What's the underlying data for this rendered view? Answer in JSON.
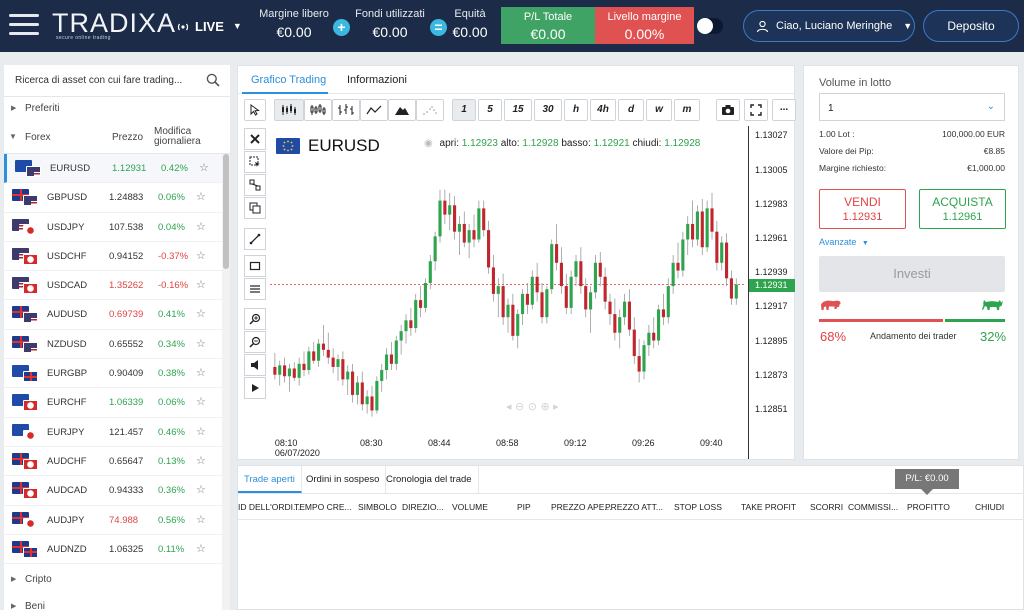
{
  "header": {
    "logo": "TRADIXA",
    "logo_tagline": "secure online trading",
    "account_mode": "LIVE",
    "free_margin_label": "Margine libero",
    "free_margin_value": "€0.00",
    "used_funds_label": "Fondi utilizzati",
    "used_funds_value": "€0.00",
    "equity_label": "Equità",
    "equity_value": "€0.00",
    "total_pl_label": "P/L Totale",
    "total_pl_value": "€0.00",
    "margin_level_label": "Livello margine",
    "margin_level_value": "0.00%",
    "greeting": "Ciao, Luciano Meringhe",
    "deposit_label": "Deposito",
    "colors": {
      "bg": "#1b2b48",
      "pl": "#3fa365",
      "margin": "#e05151",
      "accent": "#3c79c9"
    }
  },
  "sidebar": {
    "search_placeholder": "Ricerca di asset con cui fare trading...",
    "favorites_label": "Preferiti",
    "forex_label": "Forex",
    "col_price": "Prezzo",
    "col_change_1": "Modifica",
    "col_change_2": "giornaliera",
    "crypto_label": "Cripto",
    "goods_label": "Beni",
    "instruments": [
      {
        "symbol": "EURUSD",
        "price": "1.12931",
        "change": "0.42%",
        "price_dir": "up",
        "change_dir": "up",
        "f1": "eu",
        "f2": "us"
      },
      {
        "symbol": "GBPUSD",
        "price": "1.24883",
        "change": "0.06%",
        "price_dir": "flat",
        "change_dir": "up",
        "f1": "gb",
        "f2": "us"
      },
      {
        "symbol": "USDJPY",
        "price": "107.538",
        "change": "0.04%",
        "price_dir": "flat",
        "change_dir": "up",
        "f1": "us",
        "f2": "jp"
      },
      {
        "symbol": "USDCHF",
        "price": "0.94152",
        "change": "-0.37%",
        "price_dir": "flat",
        "change_dir": "down",
        "f1": "us",
        "f2": "ch"
      },
      {
        "symbol": "USDCAD",
        "price": "1.35262",
        "change": "-0.16%",
        "price_dir": "down",
        "change_dir": "down",
        "f1": "us",
        "f2": "ca"
      },
      {
        "symbol": "AUDUSD",
        "price": "0.69739",
        "change": "0.41%",
        "price_dir": "down",
        "change_dir": "up",
        "f1": "au",
        "f2": "us"
      },
      {
        "symbol": "NZDUSD",
        "price": "0.65552",
        "change": "0.34%",
        "price_dir": "flat",
        "change_dir": "up",
        "f1": "nz",
        "f2": "us"
      },
      {
        "symbol": "EURGBP",
        "price": "0.90409",
        "change": "0.38%",
        "price_dir": "flat",
        "change_dir": "up",
        "f1": "eu",
        "f2": "gb"
      },
      {
        "symbol": "EURCHF",
        "price": "1.06339",
        "change": "0.06%",
        "price_dir": "up",
        "change_dir": "up",
        "f1": "eu",
        "f2": "ch"
      },
      {
        "symbol": "EURJPY",
        "price": "121.457",
        "change": "0.46%",
        "price_dir": "flat",
        "change_dir": "up",
        "f1": "eu",
        "f2": "jp"
      },
      {
        "symbol": "AUDCHF",
        "price": "0.65647",
        "change": "0.13%",
        "price_dir": "flat",
        "change_dir": "up",
        "f1": "au",
        "f2": "ch"
      },
      {
        "symbol": "AUDCAD",
        "price": "0.94333",
        "change": "0.36%",
        "price_dir": "flat",
        "change_dir": "up",
        "f1": "au",
        "f2": "ca"
      },
      {
        "symbol": "AUDJPY",
        "price": "74.988",
        "change": "0.56%",
        "price_dir": "down",
        "change_dir": "up",
        "f1": "au",
        "f2": "jp"
      },
      {
        "symbol": "AUDNZD",
        "price": "1.06325",
        "change": "0.11%",
        "price_dir": "flat",
        "change_dir": "up",
        "f1": "au",
        "f2": "nz"
      }
    ]
  },
  "chart_panel": {
    "tab_chart": "Grafico Trading",
    "tab_info": "Informazioni",
    "timeframes": [
      "1",
      "5",
      "15",
      "30",
      "h",
      "4h",
      "d",
      "w",
      "m"
    ],
    "selected_timeframe": "1",
    "more_label": "...",
    "symbol": "EURUSD",
    "ohlc_open_label": "apri:",
    "ohlc_open": "1.12923",
    "ohlc_high_label": "alto:",
    "ohlc_high": "1.12928",
    "ohlc_low_label": "basso:",
    "ohlc_low": "1.12921",
    "ohlc_close_label": "chiudi:",
    "ohlc_close": "1.12928",
    "current_price": "1.12931"
  },
  "chart_data": {
    "type": "candlestick",
    "y_ticks": [
      "1.13027",
      "1.13005",
      "1.12983",
      "1.12961",
      "1.12939",
      "1.12917",
      "1.12895",
      "1.12873",
      "1.12851"
    ],
    "ylim": [
      1.1284,
      1.13033
    ],
    "x_ticks": [
      {
        "label": "08:10",
        "sub": "06/07/2020",
        "index": 0
      },
      {
        "label": "08:30",
        "index": 20
      },
      {
        "label": "08:44",
        "index": 34
      },
      {
        "label": "08:58",
        "index": 48
      },
      {
        "label": "09:12",
        "index": 62
      },
      {
        "label": "09:26",
        "index": 76
      },
      {
        "label": "09:40",
        "index": 90
      }
    ],
    "candles": [
      [
        1.12878,
        1.12887,
        1.1287,
        1.12873
      ],
      [
        1.12873,
        1.12882,
        1.12866,
        1.12879
      ],
      [
        1.12879,
        1.12884,
        1.12868,
        1.12872
      ],
      [
        1.12872,
        1.1288,
        1.12862,
        1.12877
      ],
      [
        1.12877,
        1.12881,
        1.12869,
        1.12871
      ],
      [
        1.12871,
        1.12884,
        1.12866,
        1.1288
      ],
      [
        1.1288,
        1.12888,
        1.12872,
        1.12876
      ],
      [
        1.12876,
        1.12891,
        1.12873,
        1.12888
      ],
      [
        1.12888,
        1.12894,
        1.1288,
        1.12882
      ],
      [
        1.12882,
        1.12896,
        1.12878,
        1.12893
      ],
      [
        1.12893,
        1.12905,
        1.12885,
        1.12889
      ],
      [
        1.12889,
        1.129,
        1.1288,
        1.12884
      ],
      [
        1.12884,
        1.1289,
        1.12874,
        1.12878
      ],
      [
        1.12878,
        1.12886,
        1.12869,
        1.12883
      ],
      [
        1.12883,
        1.12888,
        1.12866,
        1.1287
      ],
      [
        1.1287,
        1.12879,
        1.1286,
        1.12875
      ],
      [
        1.12875,
        1.1288,
        1.12855,
        1.1286
      ],
      [
        1.1286,
        1.12872,
        1.12854,
        1.12868
      ],
      [
        1.12868,
        1.12875,
        1.1285,
        1.12854
      ],
      [
        1.12854,
        1.12863,
        1.12848,
        1.12859
      ],
      [
        1.12859,
        1.12866,
        1.12846,
        1.1285
      ],
      [
        1.1285,
        1.12872,
        1.12848,
        1.12869
      ],
      [
        1.12869,
        1.1288,
        1.12862,
        1.12876
      ],
      [
        1.12876,
        1.1289,
        1.1287,
        1.12886
      ],
      [
        1.12886,
        1.12894,
        1.12876,
        1.1288
      ],
      [
        1.1288,
        1.12898,
        1.12876,
        1.12895
      ],
      [
        1.12895,
        1.12905,
        1.12886,
        1.12901
      ],
      [
        1.12901,
        1.12912,
        1.12893,
        1.12908
      ],
      [
        1.12908,
        1.12916,
        1.12898,
        1.12903
      ],
      [
        1.12903,
        1.12925,
        1.129,
        1.12921
      ],
      [
        1.12921,
        1.1293,
        1.1291,
        1.12916
      ],
      [
        1.12916,
        1.12935,
        1.12913,
        1.12932
      ],
      [
        1.12932,
        1.1295,
        1.12928,
        1.12946
      ],
      [
        1.12946,
        1.12965,
        1.1294,
        1.12962
      ],
      [
        1.12962,
        1.12992,
        1.12958,
        1.12985
      ],
      [
        1.12985,
        1.12992,
        1.1297,
        1.12976
      ],
      [
        1.12976,
        1.1299,
        1.12966,
        1.12982
      ],
      [
        1.12982,
        1.12988,
        1.1296,
        1.12965
      ],
      [
        1.12965,
        1.12975,
        1.1295,
        1.1297
      ],
      [
        1.1297,
        1.12978,
        1.12955,
        1.12958
      ],
      [
        1.12958,
        1.1297,
        1.12948,
        1.12966
      ],
      [
        1.12966,
        1.12976,
        1.12955,
        1.1296
      ],
      [
        1.1296,
        1.12985,
        1.12958,
        1.1298
      ],
      [
        1.1298,
        1.12985,
        1.12962,
        1.12966
      ],
      [
        1.12966,
        1.12972,
        1.12938,
        1.12942
      ],
      [
        1.12942,
        1.1295,
        1.1292,
        1.12925
      ],
      [
        1.12925,
        1.12935,
        1.1291,
        1.1293
      ],
      [
        1.1293,
        1.12938,
        1.12905,
        1.1291
      ],
      [
        1.1291,
        1.12922,
        1.129,
        1.12918
      ],
      [
        1.12918,
        1.12925,
        1.12895,
        1.12898
      ],
      [
        1.12898,
        1.12915,
        1.1289,
        1.12912
      ],
      [
        1.12912,
        1.12928,
        1.12905,
        1.12925
      ],
      [
        1.12925,
        1.12932,
        1.12912,
        1.12918
      ],
      [
        1.12918,
        1.1294,
        1.12915,
        1.12936
      ],
      [
        1.12936,
        1.12945,
        1.1292,
        1.12926
      ],
      [
        1.12926,
        1.12932,
        1.12906,
        1.1291
      ],
      [
        1.1291,
        1.1293,
        1.12906,
        1.12928
      ],
      [
        1.12928,
        1.1296,
        1.12925,
        1.12957
      ],
      [
        1.12957,
        1.1297,
        1.1294,
        1.12945
      ],
      [
        1.12945,
        1.12955,
        1.12925,
        1.1293
      ],
      [
        1.1293,
        1.12938,
        1.12912,
        1.12916
      ],
      [
        1.12916,
        1.1294,
        1.12912,
        1.12936
      ],
      [
        1.12936,
        1.1295,
        1.1293,
        1.12946
      ],
      [
        1.12946,
        1.12955,
        1.12925,
        1.1293
      ],
      [
        1.1293,
        1.12935,
        1.1291,
        1.12915
      ],
      [
        1.12915,
        1.1293,
        1.129,
        1.12926
      ],
      [
        1.12926,
        1.1295,
        1.12922,
        1.12945
      ],
      [
        1.12945,
        1.12952,
        1.1293,
        1.12936
      ],
      [
        1.12936,
        1.12942,
        1.12915,
        1.1292
      ],
      [
        1.1292,
        1.12925,
        1.12905,
        1.12912
      ],
      [
        1.12912,
        1.12922,
        1.12895,
        1.129
      ],
      [
        1.129,
        1.12915,
        1.1289,
        1.1291
      ],
      [
        1.1291,
        1.12925,
        1.12905,
        1.1292
      ],
      [
        1.1292,
        1.12928,
        1.12898,
        1.12902
      ],
      [
        1.12902,
        1.1291,
        1.1288,
        1.12885
      ],
      [
        1.12885,
        1.12896,
        1.12868,
        1.12875
      ],
      [
        1.12875,
        1.12895,
        1.1287,
        1.12892
      ],
      [
        1.12892,
        1.12905,
        1.12885,
        1.129
      ],
      [
        1.129,
        1.1291,
        1.1289,
        1.12895
      ],
      [
        1.12895,
        1.12918,
        1.12892,
        1.12915
      ],
      [
        1.12915,
        1.12925,
        1.12905,
        1.1291
      ],
      [
        1.1291,
        1.12935,
        1.12906,
        1.1293
      ],
      [
        1.1293,
        1.1295,
        1.12925,
        1.12945
      ],
      [
        1.12945,
        1.12958,
        1.12935,
        1.1294
      ],
      [
        1.1294,
        1.12965,
        1.12936,
        1.1296
      ],
      [
        1.1296,
        1.12975,
        1.1295,
        1.1297
      ],
      [
        1.1297,
        1.12985,
        1.12955,
        1.1296
      ],
      [
        1.1296,
        1.12982,
        1.12956,
        1.12978
      ],
      [
        1.12978,
        1.12986,
        1.1295,
        1.12955
      ],
      [
        1.12955,
        1.12985,
        1.12952,
        1.1298
      ],
      [
        1.1298,
        1.1299,
        1.1296,
        1.12965
      ],
      [
        1.12965,
        1.12972,
        1.1294,
        1.12945
      ],
      [
        1.12945,
        1.12962,
        1.1294,
        1.12958
      ],
      [
        1.12958,
        1.12964,
        1.1293,
        1.12935
      ],
      [
        1.12935,
        1.1294,
        1.12918,
        1.12922
      ],
      [
        1.12922,
        1.12935,
        1.12918,
        1.12931
      ]
    ]
  },
  "trade_panel": {
    "lot_label": "Volume in lotto",
    "lot_value": "1",
    "lot_info_label": "1.00 Lot :",
    "lot_info_value": "100,000.00 EUR",
    "pip_label": "Valore dei Pip:",
    "pip_value": "€8.85",
    "margin_req_label": "Margine richiesto:",
    "margin_req_value": "€1,000.00",
    "sell_label": "VENDI",
    "sell_price": "1.12931",
    "buy_label": "ACQUISTA",
    "buy_price": "1.12961",
    "advanced_label": "Avanzate",
    "invest_label": "Investi",
    "bear_pct": "68%",
    "bull_pct": "32%",
    "bear_ratio": 0.68,
    "trend_label": "Andamento dei trader"
  },
  "bottom_panel": {
    "tabs": [
      "Trade aperti",
      "Ordini in sospeso",
      "Cronologia del trade"
    ],
    "pl_badge": "P/L:  €0.00",
    "columns": [
      "ID DELL'ORDI...",
      "TEMPO CRE...",
      "SIMBOLO",
      "DIREZIO...",
      "VOLUME",
      "PIP",
      "PREZZO APE...",
      "PREZZO ATT...",
      "STOP LOSS",
      "TAKE PROFIT",
      "SCORRI",
      "COMMISSI...",
      "PROFITTO",
      "CHIUDI"
    ]
  }
}
